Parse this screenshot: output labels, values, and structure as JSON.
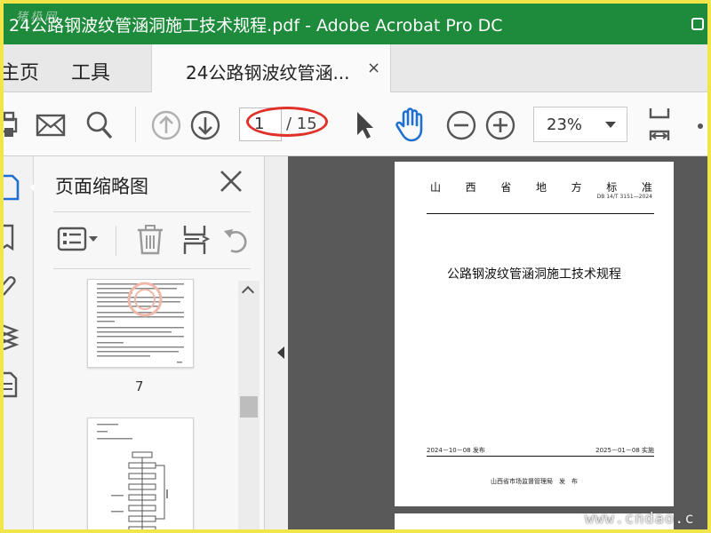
{
  "titlebar": {
    "watermark": "猪极网",
    "title": "24公路钢波纹管涵洞施工技术规程.pdf - Adobe Acrobat Pro DC"
  },
  "tabs": {
    "home": "主页",
    "tools": "工具",
    "document": "24公路钢波纹管涵...",
    "close": "×"
  },
  "toolbar": {
    "page_current": "1",
    "page_total": "/ 15",
    "zoom": "23%"
  },
  "thumbnail_panel": {
    "title": "页面缩略图",
    "page_label": "7"
  },
  "document_page": {
    "header_chars": [
      "山",
      "西",
      "省",
      "地",
      "方",
      "标",
      "准"
    ],
    "standard_no": "DB 14/T 3151—2024",
    "title": "公路钢波纹管涵洞施工技术规程",
    "issue_date": "2024－10－08 发布",
    "effective_date": "2025－01－08 实施",
    "issuer": "山西省市场监督管理局　发　布"
  },
  "site_watermark": "www.cndao.c",
  "colors": {
    "titlebar": "#1e8a3c",
    "frame": "#f0e64a",
    "hand_tool": "#1f6fd1",
    "annotation": "#e0302a"
  },
  "icons": {
    "print": "printer-icon",
    "mail": "envelope-icon",
    "search": "magnifier-icon",
    "prev_page": "arrow-up-circle-icon",
    "next_page": "arrow-down-circle-icon",
    "select": "cursor-arrow-icon",
    "hand": "hand-icon",
    "zoom_out": "minus-circle-icon",
    "zoom_in": "plus-circle-icon",
    "fit": "fit-page-icon"
  }
}
